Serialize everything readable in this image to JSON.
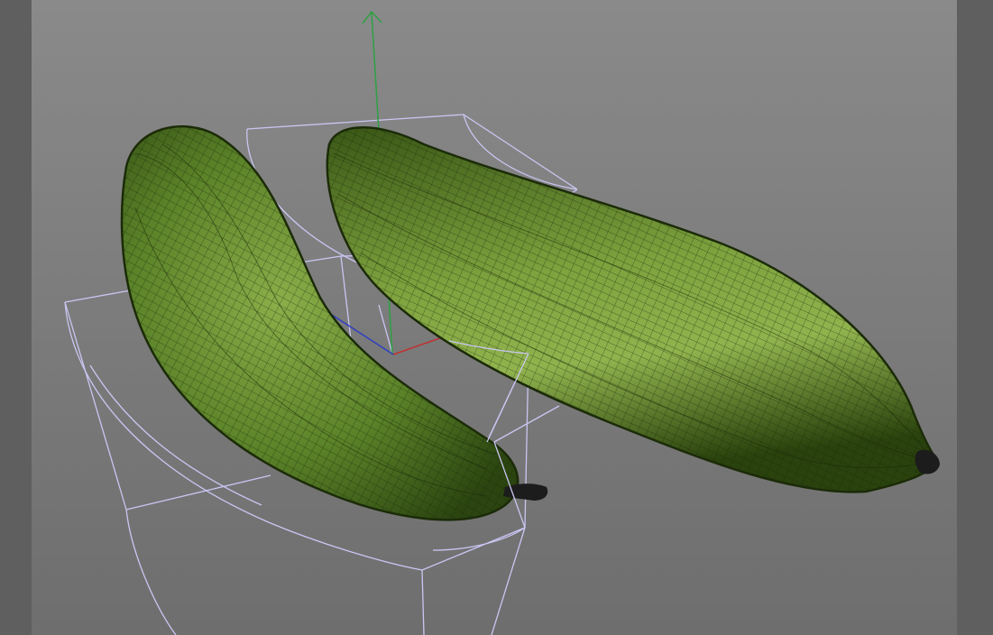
{
  "viewport": {
    "view_type": "perspective",
    "display_mode": "shaded-with-wireframe",
    "colors": {
      "background_top": "#8a8a8a",
      "background_bottom": "#6e6e6e",
      "side_panel": "#5f5f5f",
      "object_fill": "#5f8a2a",
      "object_fill_dark": "#2f4a12",
      "wireframe": "#1a2a08",
      "deformer_cage": "#c9c6f2",
      "axis_y": "#2ea043",
      "axis_x": "#c03030",
      "axis_z": "#3040c0"
    }
  },
  "scene": {
    "objects": [
      {
        "name": "cucumber-curved",
        "icon": "mesh-object"
      },
      {
        "name": "cucumber-straight",
        "icon": "mesh-object"
      }
    ],
    "deformer": {
      "icon": "bend-deformer-cage"
    },
    "axis_gizmo": {
      "axes": [
        "x",
        "y",
        "z"
      ]
    }
  }
}
